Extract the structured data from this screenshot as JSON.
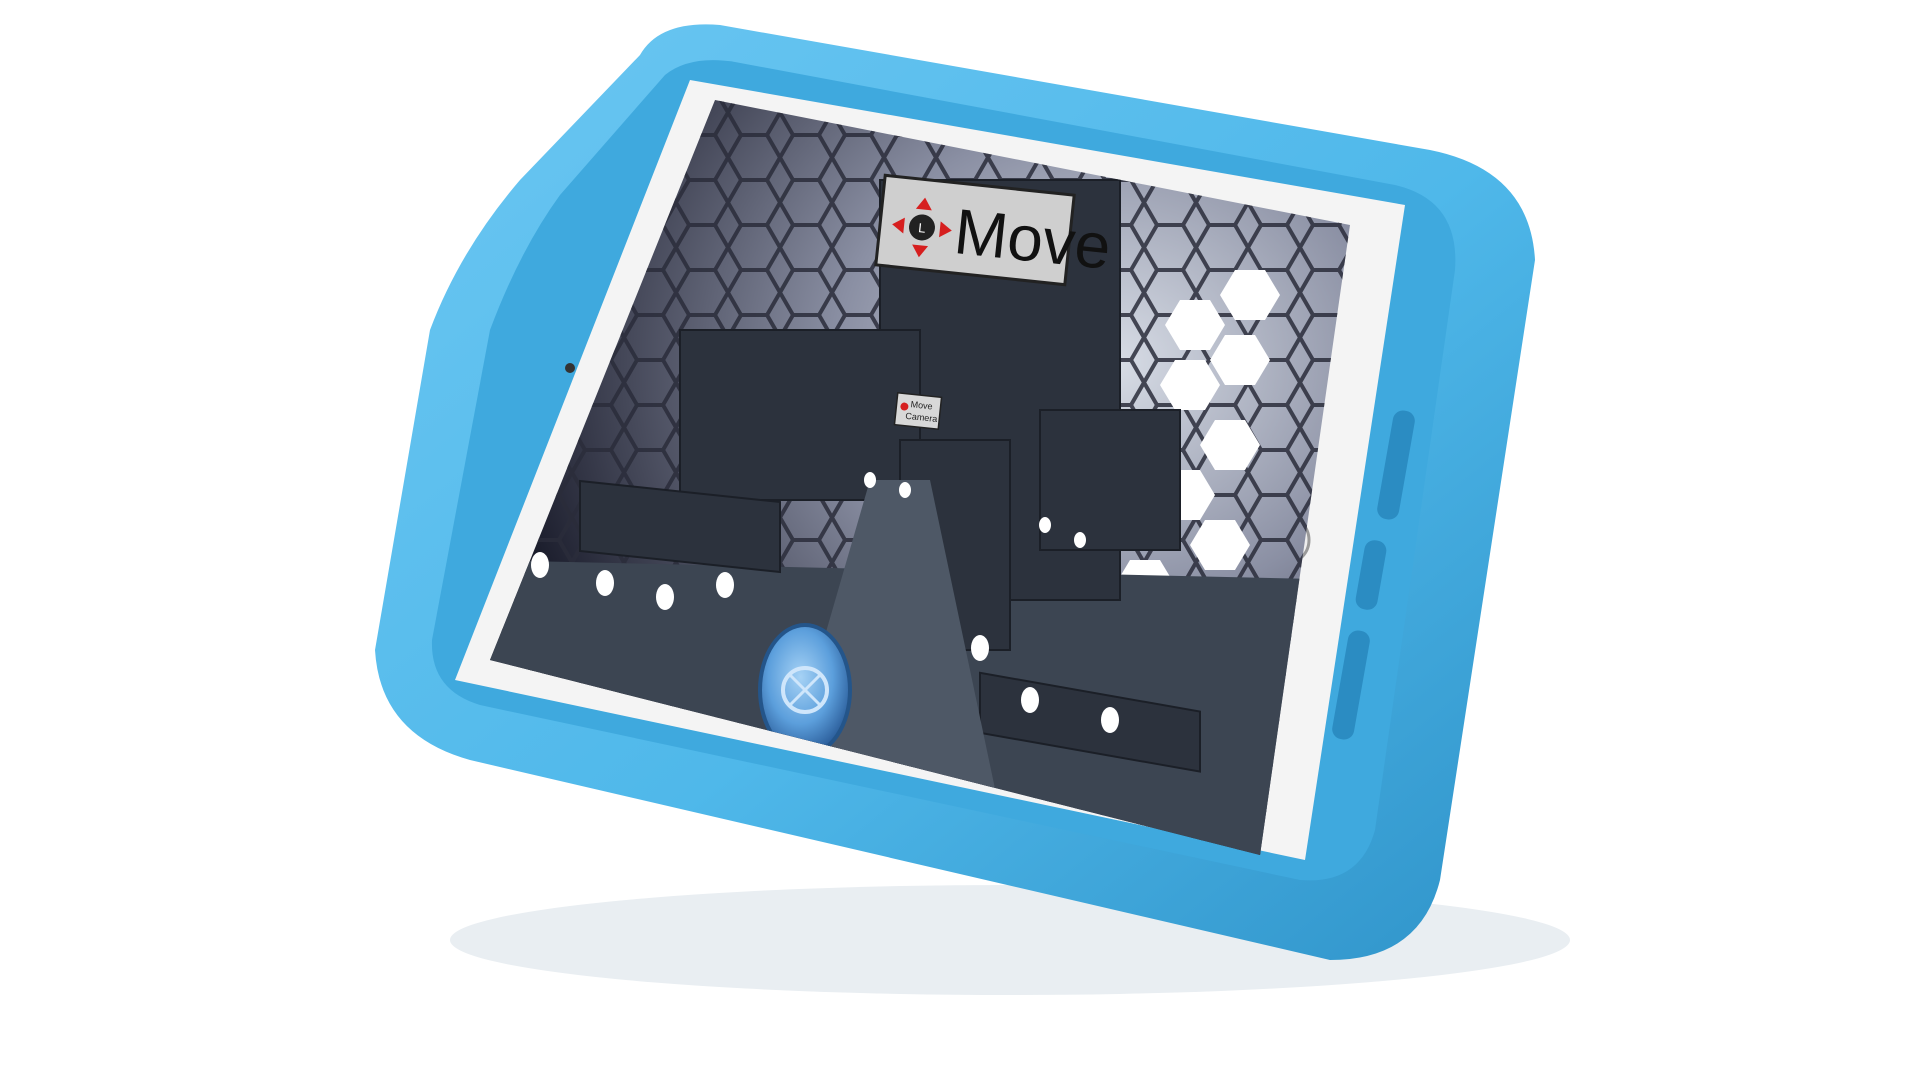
{
  "scene": {
    "device": "tablet",
    "case_color": "#4fb8ea",
    "case_shadow_color": "#2f93c9",
    "bezel_color": "#f4f4f4",
    "screen_bg": "#1a1c2a"
  },
  "game": {
    "move_sign": {
      "label": "Move",
      "joystick_letter": "L"
    },
    "camera_sign": {
      "line1": "Move",
      "line2": "Camera"
    },
    "player_ball": {
      "color": "#6aa8e0",
      "accent": "#2f6fb8"
    },
    "hex_tiles_color": "#ffffff",
    "floor_color": "#3c4552"
  }
}
